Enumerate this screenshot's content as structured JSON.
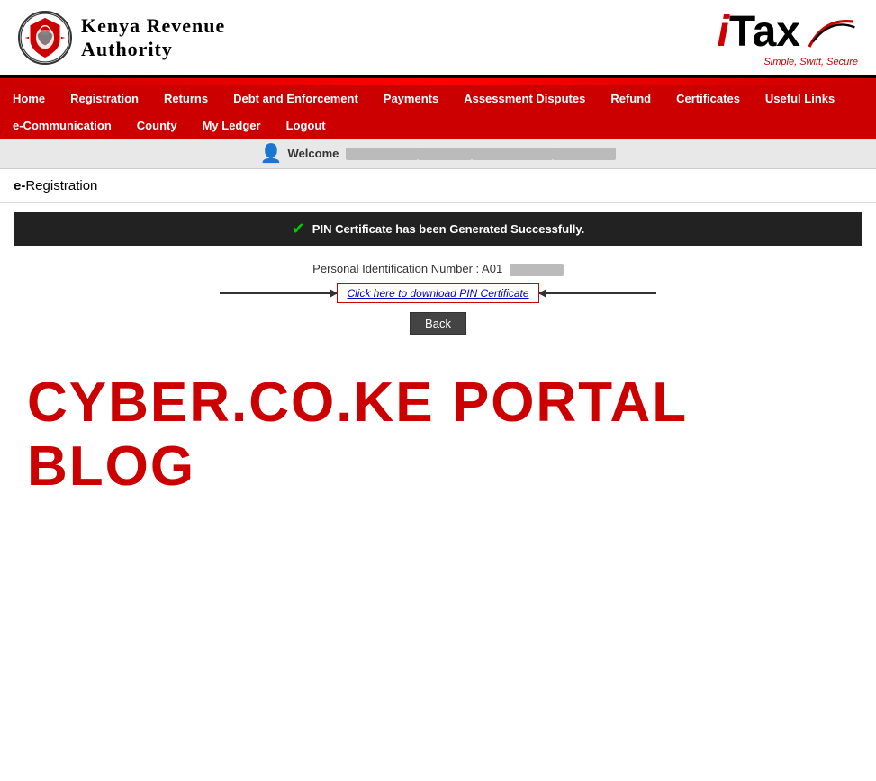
{
  "header": {
    "kra_line1": "Kenya Revenue",
    "kra_line2": "Authority",
    "itax_i": "i",
    "itax_tax": "Tax",
    "itax_tagline": "Simple, Swift, Secure"
  },
  "nav": {
    "row1": [
      {
        "label": "Home",
        "id": "home"
      },
      {
        "label": "Registration",
        "id": "registration"
      },
      {
        "label": "Returns",
        "id": "returns"
      },
      {
        "label": "Debt and Enforcement",
        "id": "debt"
      },
      {
        "label": "Payments",
        "id": "payments"
      },
      {
        "label": "Assessment Disputes",
        "id": "disputes"
      },
      {
        "label": "Refund",
        "id": "refund"
      },
      {
        "label": "Certificates",
        "id": "certificates"
      },
      {
        "label": "Useful Links",
        "id": "links"
      }
    ],
    "row2": [
      {
        "label": "e-Communication",
        "id": "ecomm"
      },
      {
        "label": "County",
        "id": "county"
      },
      {
        "label": "My Ledger",
        "id": "ledger"
      },
      {
        "label": "Logout",
        "id": "logout"
      }
    ]
  },
  "welcome": {
    "label": "Welcome"
  },
  "page": {
    "title": "e-Registration",
    "success_message": "PIN Certificate has been Generated Successfully.",
    "pin_label": "Personal Identification Number : A01",
    "download_link": "Click here to download PIN Certificate",
    "back_button": "Back"
  },
  "watermark": {
    "text": "CYBER.CO.KE PORTAL BLOG"
  }
}
